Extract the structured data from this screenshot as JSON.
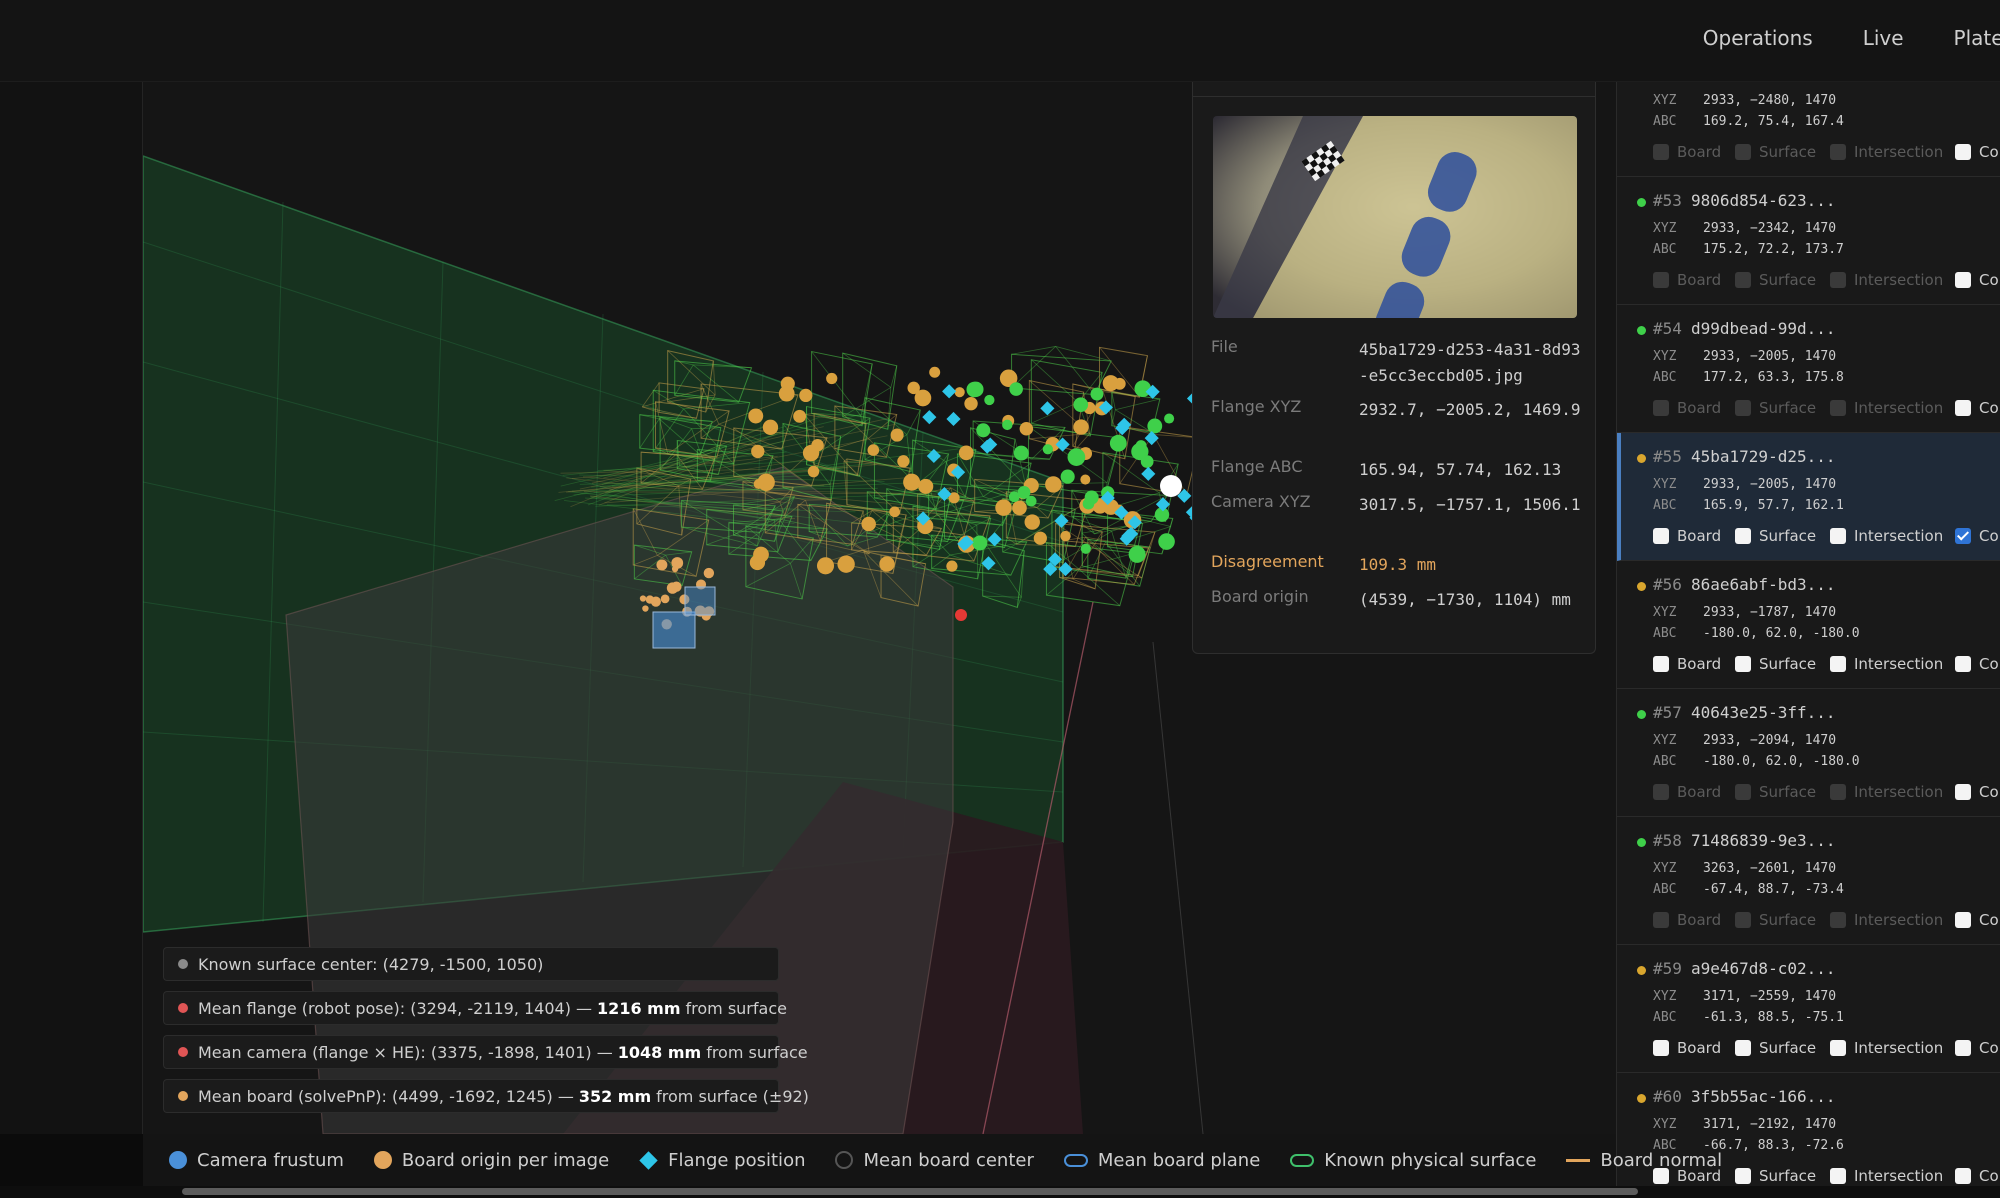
{
  "nav": {
    "items": [
      "Operations",
      "Live",
      "Plates"
    ]
  },
  "detail": {
    "rows": [
      {
        "key": "File",
        "value": "45ba1729-d253-4a31-8d93-e5cc3eccbd05.jpg"
      },
      {
        "key": "Flange XYZ",
        "value": "2932.7, −2005.2, 1469.9"
      },
      {
        "key": "Flange ABC",
        "value": "165.94, 57.74, 162.13"
      },
      {
        "key": "Camera XYZ",
        "value": "3017.5, −1757.1, 1506.1"
      },
      {
        "key": "Disagreement",
        "value": "109.3 mm"
      },
      {
        "key": "Board origin",
        "value": "(4539, −1730, 1104) mm"
      }
    ]
  },
  "infos": [
    {
      "text": "Known surface center: (4279, -1500, 1050)",
      "bold": "",
      "suffix": "",
      "color": "#8a8a8a"
    },
    {
      "text": "Mean flange (robot pose): (3294, -2119, 1404) —",
      "bold": "1216 mm",
      "suffix": "from surface",
      "color": "#e05555"
    },
    {
      "text": "Mean camera (flange × HE): (3375, -1898, 1401) —",
      "bold": "1048 mm",
      "suffix": "from surface",
      "color": "#e05555"
    },
    {
      "text": "Mean board (solvePnP): (4499, -1692, 1245) —",
      "bold": "352 mm",
      "suffix": "from surface (±92)",
      "color": "#e2a55c"
    }
  ],
  "legend": [
    {
      "label": "Camera frustum",
      "shape": "circle",
      "color": "#4a90d9"
    },
    {
      "label": "Board origin per image",
      "shape": "circle",
      "color": "#e2a55c"
    },
    {
      "label": "Flange position",
      "shape": "diamond",
      "color": "#2ec5e8"
    },
    {
      "label": "Mean board center",
      "shape": "ring",
      "color": "#555555"
    },
    {
      "label": "Mean board plane",
      "shape": "pill",
      "color": "#4a90d9"
    },
    {
      "label": "Known physical surface",
      "shape": "pill",
      "color": "#3fbf6b"
    },
    {
      "label": "Board normal",
      "shape": "line",
      "color": "#e2a55c"
    }
  ],
  "checkbox_labels": {
    "board": "Board",
    "surface": "Surface",
    "intersection": "Intersection",
    "cut": "Co"
  },
  "coord_labels": {
    "xyz": "XYZ",
    "abc": "ABC"
  },
  "cards": [
    {
      "num": "",
      "id": "",
      "status": "",
      "xyz": "2933, −2480, 1470",
      "abc": "169.2, 75.4, 167.4",
      "enabled": false,
      "selected": false,
      "checked": [
        false,
        false,
        false,
        false
      ]
    },
    {
      "num": "#53",
      "id": "9806d854-623...",
      "status": "#3fd04a",
      "xyz": "2933, −2342, 1470",
      "abc": "175.2, 72.2, 173.7",
      "enabled": false,
      "selected": false,
      "checked": [
        false,
        false,
        false,
        false
      ]
    },
    {
      "num": "#54",
      "id": "d99dbead-99d...",
      "status": "#3fd04a",
      "xyz": "2933, −2005, 1470",
      "abc": "177.2, 63.3, 175.8",
      "enabled": false,
      "selected": false,
      "checked": [
        false,
        false,
        false,
        false
      ]
    },
    {
      "num": "#55",
      "id": "45ba1729-d25...",
      "status": "#d9a62e",
      "xyz": "2933, −2005, 1470",
      "abc": "165.9, 57.7, 162.1",
      "enabled": true,
      "selected": true,
      "checked": [
        false,
        false,
        false,
        true
      ]
    },
    {
      "num": "#56",
      "id": "86ae6abf-bd3...",
      "status": "#d9a62e",
      "xyz": "2933, −1787, 1470",
      "abc": "-180.0, 62.0, -180.0",
      "enabled": true,
      "selected": false,
      "checked": [
        false,
        false,
        false,
        false
      ]
    },
    {
      "num": "#57",
      "id": "40643e25-3ff...",
      "status": "#3fd04a",
      "xyz": "2933, −2094, 1470",
      "abc": "-180.0, 62.0, -180.0",
      "enabled": false,
      "selected": false,
      "checked": [
        false,
        false,
        false,
        false
      ]
    },
    {
      "num": "#58",
      "id": "71486839-9e3...",
      "status": "#3fd04a",
      "xyz": "3263, −2601, 1470",
      "abc": "-67.4, 88.7, -73.4",
      "enabled": false,
      "selected": false,
      "checked": [
        false,
        false,
        false,
        false
      ]
    },
    {
      "num": "#59",
      "id": "a9e467d8-c02...",
      "status": "#d9a62e",
      "xyz": "3171, −2559, 1470",
      "abc": "-61.3, 88.5, -75.1",
      "enabled": true,
      "selected": false,
      "checked": [
        false,
        false,
        false,
        false
      ]
    },
    {
      "num": "#60",
      "id": "3f5b55ac-166...",
      "status": "#d9a62e",
      "xyz": "3171, −2192, 1470",
      "abc": "-66.7, 88.3, -72.6",
      "enabled": true,
      "selected": false,
      "checked": [
        false,
        false,
        false,
        false
      ]
    }
  ]
}
